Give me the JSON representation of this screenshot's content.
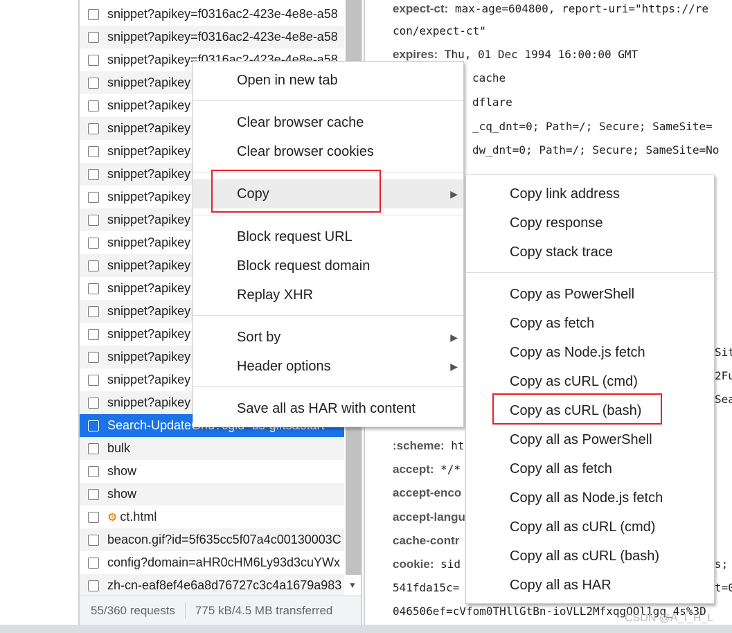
{
  "requests": [
    {
      "name": "snippet?apikey=f0316ac2-423e-4e8e-a58"
    },
    {
      "name": "snippet?apikey=f0316ac2-423e-4e8e-a58"
    },
    {
      "name": "snippet?apikey=f0316ac2-423e-4e8e-a58"
    },
    {
      "name": "snippet?apikey"
    },
    {
      "name": "snippet?apikey"
    },
    {
      "name": "snippet?apikey"
    },
    {
      "name": "snippet?apikey"
    },
    {
      "name": "snippet?apikey"
    },
    {
      "name": "snippet?apikey"
    },
    {
      "name": "snippet?apikey"
    },
    {
      "name": "snippet?apikey"
    },
    {
      "name": "snippet?apikey"
    },
    {
      "name": "snippet?apikey"
    },
    {
      "name": "snippet?apikey"
    },
    {
      "name": "snippet?apikey"
    },
    {
      "name": "snippet?apikey"
    },
    {
      "name": "snippet?apikey"
    },
    {
      "name": "snippet?apikey"
    },
    {
      "name": "Search-UpdateGrid?cgid=us-gifts&start=",
      "selected": true
    },
    {
      "name": "bulk"
    },
    {
      "name": "show"
    },
    {
      "name": "show"
    },
    {
      "name": "ct.html",
      "icon": "gear-icon"
    },
    {
      "name": "beacon.gif?id=5f635cc5f07a4c00130003C"
    },
    {
      "name": "config?domain=aHR0cHM6Ly93d3cuYWx"
    },
    {
      "name": "zh-cn-eaf8ef4e6a8d76727c3c4a1679a983"
    }
  ],
  "footer": {
    "requests": "55/360 requests",
    "transferred": "775 kB/4.5 MB transferred"
  },
  "details": {
    "lines": [
      {
        "key": "expect-ct:",
        "value": " max-age=604800, report-uri=\"https://re"
      },
      {
        "key": "",
        "value": "con/expect-ct\""
      },
      {
        "key": "expires:",
        "value": " Thu, 01 Dec 1994 16:00:00 GMT"
      },
      {
        "key": "",
        "value": "cache"
      },
      {
        "key": "",
        "value": "dflare"
      },
      {
        "key": "",
        "value": "_cq_dnt=0; Path=/; Secure; SameSite="
      },
      {
        "key": "",
        "value": "dw_dnt=0; Path=/; Secure; SameSite=No"
      },
      {
        "key": ":scheme:",
        "value": " ht"
      },
      {
        "key": "accept:",
        "value": " */*"
      },
      {
        "key": "accept-enco",
        "value": ""
      },
      {
        "key": "accept-langu",
        "value": ""
      },
      {
        "key": "cache-contr",
        "value": ""
      },
      {
        "key": "cookie:",
        "value": " sid"
      },
      {
        "key": "",
        "value": "541fda15c="
      },
      {
        "key": "",
        "value": "046506ef=cVfom0THllGtBn-ioVLL2MfxqgOOl1gq_4s%3D"
      }
    ],
    "fragments": [
      "Sit",
      "2Fu",
      "Sea",
      "s;",
      "t=0"
    ]
  },
  "context_menu": {
    "items": [
      "Open in new tab",
      "Clear browser cache",
      "Clear browser cookies",
      "Copy",
      "Block request URL",
      "Block request domain",
      "Replay XHR",
      "Sort by",
      "Header options",
      "Save all as HAR with content"
    ]
  },
  "copy_submenu": {
    "items": [
      "Copy link address",
      "Copy response",
      "Copy stack trace",
      "Copy as PowerShell",
      "Copy as fetch",
      "Copy as Node.js fetch",
      "Copy as cURL (cmd)",
      "Copy as cURL (bash)",
      "Copy all as PowerShell",
      "Copy all as fetch",
      "Copy all as Node.js fetch",
      "Copy all as cURL (cmd)",
      "Copy all as cURL (bash)",
      "Copy all as HAR"
    ]
  },
  "watermark": "CSDN @A_I_H_L",
  "colors": {
    "selected": "#1a73e8",
    "highlight_box": "#e8202a"
  }
}
